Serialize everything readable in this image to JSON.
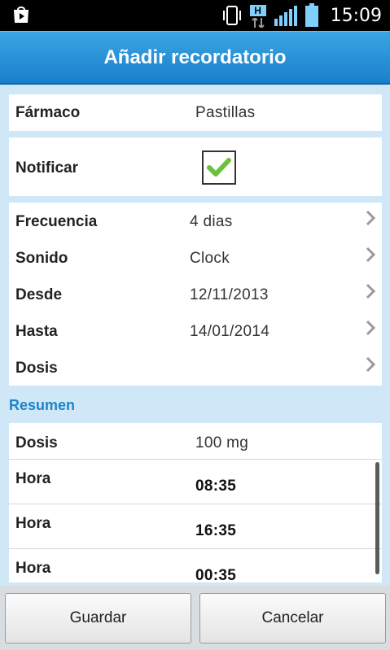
{
  "status_bar": {
    "time": "15:09",
    "network_label": "H",
    "icons": [
      "play-store-icon",
      "vibrate-icon",
      "network-h-icon",
      "signal-icon",
      "battery-icon"
    ]
  },
  "title": "Añadir recordatorio",
  "farmaco": {
    "label": "Fármaco",
    "value": "Pastillas"
  },
  "notificar": {
    "label": "Notificar",
    "checked": true
  },
  "settings": [
    {
      "label": "Frecuencia",
      "value": "4 dias"
    },
    {
      "label": "Sonido",
      "value": "Clock"
    },
    {
      "label": "Desde",
      "value": "12/11/2013"
    },
    {
      "label": "Hasta",
      "value": "14/01/2014"
    },
    {
      "label": "Dosis",
      "value": ""
    }
  ],
  "resumen": {
    "title": "Resumen",
    "dosis": {
      "label": "Dosis",
      "value": "100 mg"
    },
    "horas": [
      {
        "label": "Hora",
        "value": "08:35"
      },
      {
        "label": "Hora",
        "value": "16:35"
      },
      {
        "label": "Hora",
        "value": "00:35"
      }
    ]
  },
  "buttons": {
    "save": "Guardar",
    "cancel": "Cancelar"
  },
  "colors": {
    "accent": "#1d86c6",
    "title_bar": "#2a93d9",
    "background": "#cfe7f6",
    "check": "#6cc23a"
  }
}
